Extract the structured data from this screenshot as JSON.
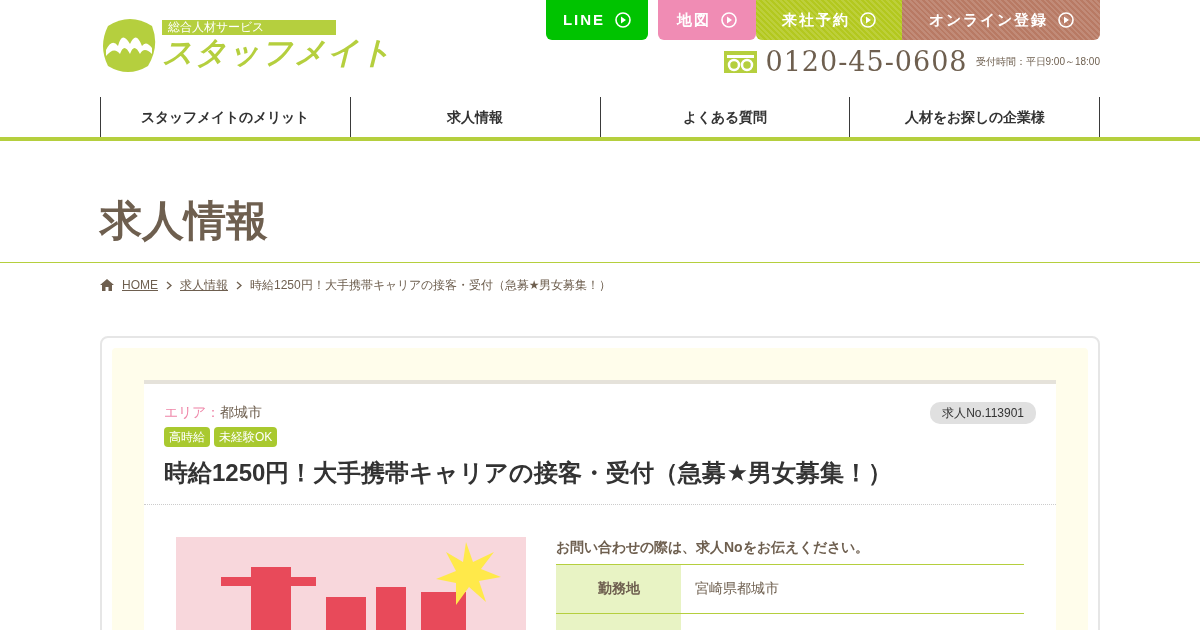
{
  "header": {
    "logo": {
      "tagline": "総合人材サービス",
      "name": "スタッフメイト"
    },
    "buttons": [
      {
        "label": "LINE",
        "color": "#00c300"
      },
      {
        "label": "地図",
        "color": "#f08cb4"
      },
      {
        "label": "来社予約",
        "color": "#b3c81e"
      },
      {
        "label": "オンライン登録",
        "color": "#b87a64"
      }
    ],
    "phone": "0120-45-0608",
    "hours": "受付時間：平日9:00～18:00"
  },
  "nav": [
    "スタッフメイトのメリット",
    "求人情報",
    "よくある質問",
    "人材をお探しの企業様"
  ],
  "page_title": "求人情報",
  "breadcrumb": [
    {
      "label": "HOME",
      "link": true
    },
    {
      "label": "求人情報",
      "link": true
    },
    {
      "label": "時給1250円！大手携帯キャリアの接客・受付（急募★男女募集！）",
      "link": false
    }
  ],
  "job": {
    "area_label": "エリア：",
    "area": "都城市",
    "job_no": "求人No.113901",
    "tags": [
      "高時給",
      "未経験OK"
    ],
    "title": "時給1250円！大手携帯キャリアの接客・受付（急募★男女募集！）",
    "notice": "お問い合わせの際は、求人Noをお伝えください。",
    "details": [
      {
        "label": "勤務地",
        "value": "宮崎県都城市"
      }
    ]
  }
}
